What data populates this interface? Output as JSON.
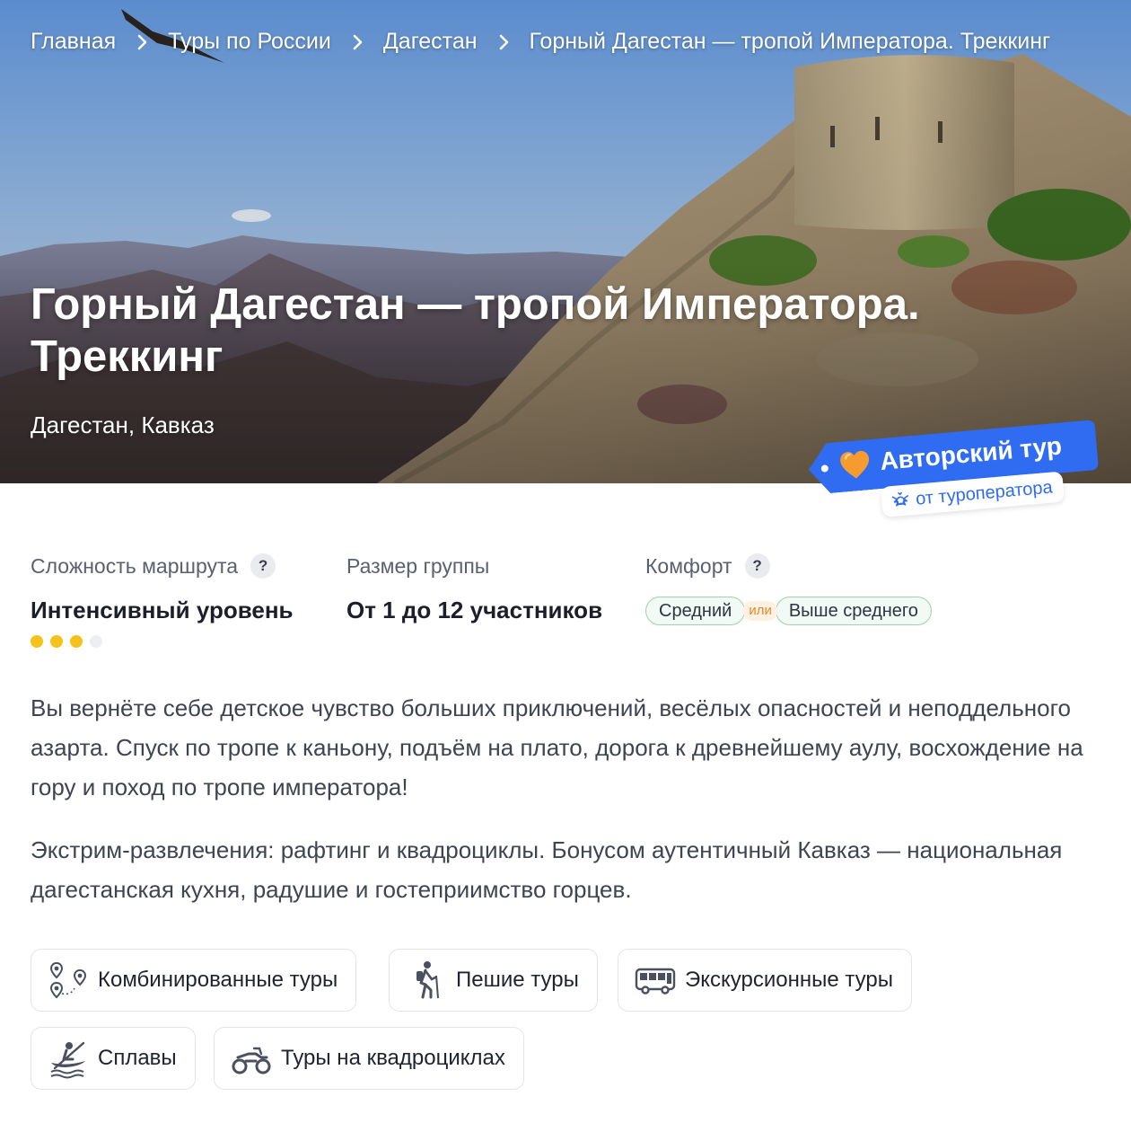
{
  "breadcrumb": [
    {
      "label": "Главная"
    },
    {
      "label": "Туры по России"
    },
    {
      "label": "Дагестан"
    },
    {
      "label": "Горный Дагестан — тропой Императора. Треккинг"
    }
  ],
  "hero": {
    "title": "Горный Дагестан — тропой Императора. Треккинг",
    "subtitle": "Дагестан, Кавказ"
  },
  "badge": {
    "title": "Авторский тур",
    "subtitle": "от туроператора",
    "heart_icon": "orange-heart-icon",
    "emblem_icon": "eagle-emblem-icon"
  },
  "facts": {
    "difficulty": {
      "label": "Сложность маршрута",
      "value": "Интенсивный уровень",
      "level": 3,
      "max_level": 4
    },
    "group": {
      "label": "Размер группы",
      "value": "От 1 до 12 участников"
    },
    "comfort": {
      "label": "Комфорт",
      "option_a": "Средний",
      "or": "или",
      "option_b": "Выше среднего"
    }
  },
  "description": {
    "p1": "Вы вернёте себе детское чувство больших приключений, весёлых опасностей и неподдельного азарта. Спуск по тропе к каньону, подъём на плато, дорога к древнейшему аулу, восхождение на гору и поход по тропе императора!",
    "p2": "Экстрим-развлечения: рафтинг и квадроциклы. Бонусом аутентичный Кавказ — национальная дагестанская кухня, радушие и гостеприимство горцев."
  },
  "categories": [
    {
      "label": "Комбинированные туры",
      "icon": "route-pins-icon"
    },
    {
      "label": "Пешие туры",
      "icon": "hiker-icon"
    },
    {
      "label": "Экскурсионные туры",
      "icon": "bus-icon"
    },
    {
      "label": "Сплавы",
      "icon": "kayak-icon"
    },
    {
      "label": "Туры на квадроциклах",
      "icon": "atv-icon"
    }
  ],
  "colors": {
    "accent_blue": "#2f6cf2",
    "difficulty_dot": "#f4c21b",
    "comfort_chip_border": "#9bd3b0",
    "or_text": "#e38a2b"
  }
}
